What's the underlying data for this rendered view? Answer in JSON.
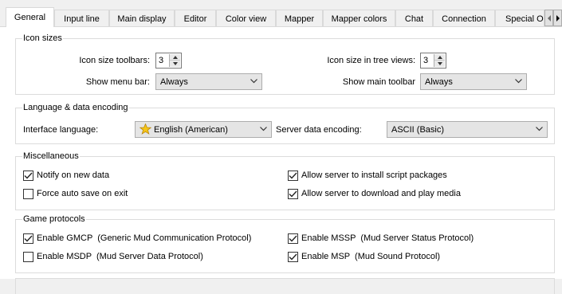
{
  "tabs": [
    {
      "label": "General",
      "active": true
    },
    {
      "label": "Input line"
    },
    {
      "label": "Main display"
    },
    {
      "label": "Editor"
    },
    {
      "label": "Color view"
    },
    {
      "label": "Mapper"
    },
    {
      "label": "Mapper colors"
    },
    {
      "label": "Chat"
    },
    {
      "label": "Connection"
    },
    {
      "label": "Special Op"
    }
  ],
  "icon_sizes": {
    "title": "Icon sizes",
    "toolbars_label": "Icon size toolbars:",
    "toolbars_value": "3",
    "tree_label": "Icon size in tree views:",
    "tree_value": "3",
    "menu_bar_label": "Show menu bar:",
    "menu_bar_value": "Always",
    "main_toolbar_label": "Show main toolbar",
    "main_toolbar_value": "Always"
  },
  "language": {
    "title": "Language & data encoding",
    "interface_label": "Interface language:",
    "interface_value": "English (American)",
    "encoding_label": "Server data encoding:",
    "encoding_value": "ASCII (Basic)"
  },
  "misc": {
    "title": "Miscellaneous",
    "notify": {
      "label": "Notify on new data",
      "checked": true
    },
    "force_save": {
      "label": "Force auto save on exit",
      "checked": false
    },
    "allow_packages": {
      "label": "Allow server to install script packages",
      "checked": true
    },
    "allow_media": {
      "label": "Allow server to download and play media",
      "checked": true
    }
  },
  "protocols": {
    "title": "Game protocols",
    "gmcp": {
      "label": "Enable GMCP  (Generic Mud Communication Protocol)",
      "checked": true
    },
    "msdp": {
      "label": "Enable MSDP  (Mud Server Data Protocol)",
      "checked": false
    },
    "mssp": {
      "label": "Enable MSSP  (Mud Server Status Protocol)",
      "checked": true
    },
    "msp": {
      "label": "Enable MSP  (Mud Sound Protocol)",
      "checked": true
    }
  },
  "colors": {
    "accent": "#0078d7",
    "border": "#dcdcdc",
    "page": "#ffffff"
  },
  "icons": [
    "scroll-left-icon",
    "scroll-right-icon",
    "dropdown-arrow-icon",
    "flag-icon",
    "checkmark-icon"
  ]
}
